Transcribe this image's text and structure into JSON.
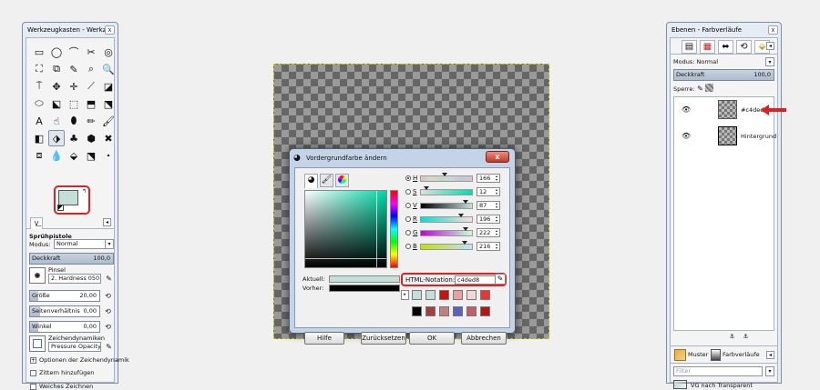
{
  "toolbox": {
    "title": "Werkzeugkasten - Werkz...",
    "tools": [
      "▭",
      "◯",
      "⌒",
      "✂",
      "◎",
      "⛶",
      "⧉",
      "✎",
      "⌕",
      "🔍",
      "⍑",
      "✥",
      "✛",
      "⟋",
      "◪",
      "⬭",
      "⬕",
      "⬚",
      "⬒",
      "⬔",
      "A",
      "☝",
      "⬮",
      "✏",
      "🖌",
      "◧",
      "⬗",
      "♣",
      "⬢",
      "✖",
      "⧈",
      "💧",
      "⬙",
      "⬔",
      "⬝"
    ],
    "fg_color": "#c4ded8",
    "bg_color": "#ffffff",
    "tab_icon": "V͟",
    "options": {
      "title": "Sprühpistole",
      "mode_label": "Modus:",
      "mode_value": "Normal",
      "opacity_label": "Deckkraft",
      "opacity_value": "100,0",
      "brush_label": "Pinsel",
      "brush_value": "2. Hardness 050",
      "size_label": "Größe",
      "size_value": "20,00",
      "aspect_label": "Seitenverhältnis",
      "aspect_value": "0,00",
      "angle_label": "Winkel",
      "angle_value": "0,00",
      "dynamics_label": "Zeichendynamiken",
      "dynamics_value": "Pressure Opacity",
      "dynamics_options": "Optionen der Zeichendynamik",
      "jitter": "Zittern hinzufügen",
      "smooth": "Weiches Zeichnen"
    }
  },
  "dialog": {
    "title": "Vordergrundfarbe ändern",
    "current_label": "Aktuell:",
    "previous_label": "Vorher:",
    "current_color": "#c4ded8",
    "previous_color": "#000000",
    "channels": [
      {
        "key": "H",
        "value": "166",
        "grad": "linear-gradient(to right,#d8c4c4,#d8d8c4,#c4d8c4,#c4d8d8,#c4c4d8,#d8c4d8)",
        "marker": 0.46
      },
      {
        "key": "S",
        "value": "12",
        "grad": "linear-gradient(to right,#dedede,#00deaa)",
        "marker": 0.12
      },
      {
        "key": "V",
        "value": "87",
        "grad": "linear-gradient(to right,#000,#c4ded8)",
        "marker": 0.87
      },
      {
        "key": "R",
        "value": "196",
        "grad": "linear-gradient(to right,#00ded8,#ffded8)",
        "marker": 0.77
      },
      {
        "key": "G",
        "value": "222",
        "grad": "linear-gradient(to right,#c400d8,#c4ffd8)",
        "marker": 0.87
      },
      {
        "key": "B",
        "value": "216",
        "grad": "linear-gradient(to right,#c4de00,#c4deff)",
        "marker": 0.85
      }
    ],
    "html_label": "HTML-Notation:",
    "html_value": "c4ded8",
    "history_row1": [
      "#c4ded8",
      "#c4ded8",
      "#cc1111",
      "#e8a0a0",
      "#f0d8d8",
      "#ee3333"
    ],
    "history_row2": [
      "#000000",
      "#a04040",
      "#c48080",
      "#6060c0",
      "#c06060",
      "#b01818"
    ],
    "buttons": {
      "help": "Hilfe",
      "reset": "Zurücksetzen",
      "ok": "OK",
      "cancel": "Abbrechen"
    }
  },
  "layers": {
    "title": "Ebenen - Farbverläufe",
    "tab_icons": [
      "▤",
      "▦",
      "⬌",
      "⟲",
      "⬙"
    ],
    "mode_label": "Modus:",
    "mode_value": "Normal",
    "opacity_label": "Deckkraft",
    "opacity_value": "100,0",
    "lock_label": "Sperre:",
    "items": [
      {
        "name": "#c4ded8"
      },
      {
        "name": "Hintergrund"
      }
    ],
    "bottom_tabs": {
      "patterns": "Muster",
      "gradients": "Farbverläufe"
    },
    "filter_placeholder": "Filter",
    "gradient_item": "VG nach Transparent"
  },
  "accent_red": "#e02020"
}
